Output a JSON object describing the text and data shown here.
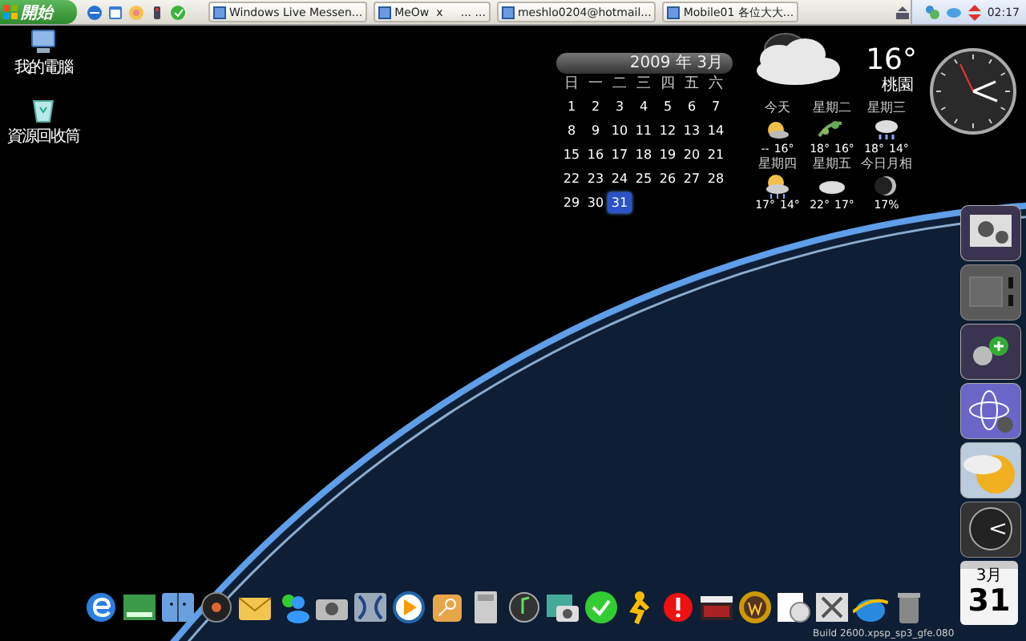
{
  "taskbar": {
    "start_button": "開始",
    "tasks": [
      {
        "label": "Windows Live Messen..."
      },
      {
        "label": "MeOw  x     ... ..."
      },
      {
        "label": "meshlo0204@hotmail..."
      },
      {
        "label": "Mobile01 各位大大..."
      }
    ],
    "clock": "02:17"
  },
  "desktop_icons": [
    {
      "label": "我的電腦",
      "kind": "computer"
    },
    {
      "label": "資源回收筒",
      "kind": "recycle"
    }
  ],
  "calendar": {
    "title": "2009 年 3月",
    "weekdays": [
      "日",
      "一",
      "二",
      "三",
      "四",
      "五",
      "六"
    ],
    "days": [
      {
        "label": "1",
        "selected": false
      },
      {
        "label": "2",
        "selected": false
      },
      {
        "label": "3",
        "selected": false
      },
      {
        "label": "4",
        "selected": false
      },
      {
        "label": "5",
        "selected": false
      },
      {
        "label": "6",
        "selected": false
      },
      {
        "label": "7",
        "selected": false
      },
      {
        "label": "8",
        "selected": false
      },
      {
        "label": "9",
        "selected": false
      },
      {
        "label": "10",
        "selected": false
      },
      {
        "label": "11",
        "selected": false
      },
      {
        "label": "12",
        "selected": false
      },
      {
        "label": "13",
        "selected": false
      },
      {
        "label": "14",
        "selected": false
      },
      {
        "label": "15",
        "selected": false
      },
      {
        "label": "16",
        "selected": false
      },
      {
        "label": "17",
        "selected": false
      },
      {
        "label": "18",
        "selected": false
      },
      {
        "label": "19",
        "selected": false
      },
      {
        "label": "20",
        "selected": false
      },
      {
        "label": "21",
        "selected": false
      },
      {
        "label": "22",
        "selected": false
      },
      {
        "label": "23",
        "selected": false
      },
      {
        "label": "24",
        "selected": false
      },
      {
        "label": "25",
        "selected": false
      },
      {
        "label": "26",
        "selected": false
      },
      {
        "label": "27",
        "selected": false
      },
      {
        "label": "28",
        "selected": false
      },
      {
        "label": "29",
        "selected": false
      },
      {
        "label": "30",
        "selected": false
      },
      {
        "label": "31",
        "selected": true
      }
    ]
  },
  "weather": {
    "temperature": "16°",
    "city": "桃園",
    "forecast": [
      {
        "day": "今天",
        "kind": "sunny",
        "high": "--",
        "low": "16°"
      },
      {
        "day": "星期二",
        "kind": "windy",
        "high": "18°",
        "low": "16°"
      },
      {
        "day": "星期三",
        "kind": "rain",
        "high": "18°",
        "low": "14°"
      },
      {
        "day": "星期四",
        "kind": "sun-rain",
        "high": "17°",
        "low": "14°"
      },
      {
        "day": "星期五",
        "kind": "cloudy",
        "high": "22°",
        "low": "17°"
      },
      {
        "day": "今日月相",
        "kind": "moon",
        "value": "17%"
      }
    ]
  },
  "build_text": "Build 2600.xpsp_sp3_gfe.080",
  "date_tile": {
    "month": "3月",
    "day": "31"
  }
}
